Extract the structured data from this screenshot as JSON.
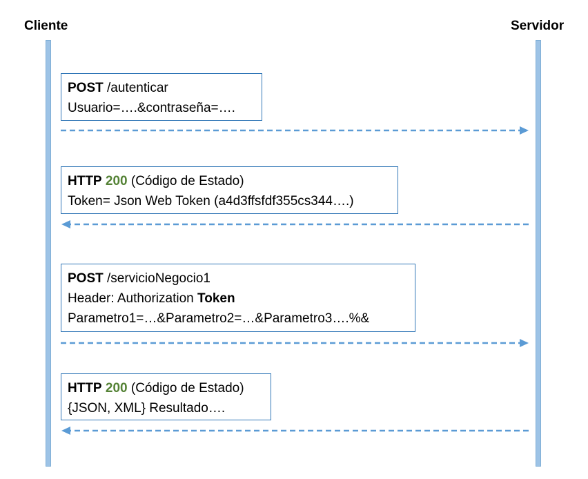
{
  "actors": {
    "client": "Cliente",
    "server": "Servidor"
  },
  "colors": {
    "lifeline_fill": "#9dc3e6",
    "arrow": "#5b9bd5",
    "box_border": "#2e75b6",
    "status_code": "#548235"
  },
  "messages": [
    {
      "direction": "client-to-server",
      "line1_bold": "POST",
      "line1_rest": " /autenticar",
      "line2": "Usuario=….&contraseña=…."
    },
    {
      "direction": "server-to-client",
      "line1_bold": "HTTP",
      "line1_code": "200",
      "line1_rest": " (Código de Estado)",
      "line2": "Token= Json Web Token (a4d3ffsfdf355cs344….)"
    },
    {
      "direction": "client-to-server",
      "line1_bold": "POST",
      "line1_rest": " /servicioNegocio1",
      "line2_prefix": "Header: Authorization",
      "line2_bold": "Token",
      "line3": "Parametro1=…&Parametro2=…&Parametro3….%&"
    },
    {
      "direction": "server-to-client",
      "line1_bold": "HTTP",
      "line1_code": "200",
      "line1_rest": " (Código de Estado)",
      "line2": "{JSON, XML} Resultado…."
    }
  ]
}
